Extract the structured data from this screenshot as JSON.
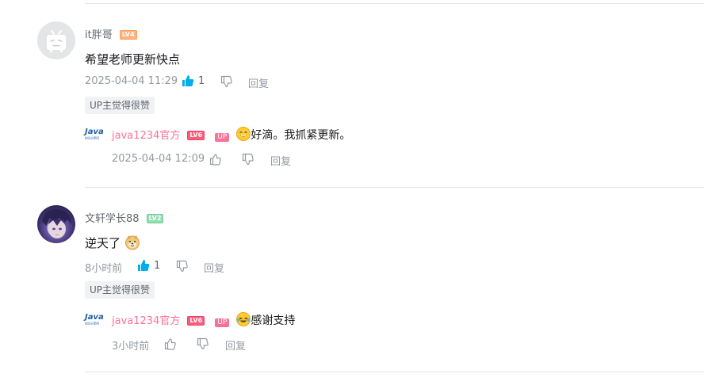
{
  "comments": [
    {
      "username": "it胖哥",
      "level": "LV4",
      "content": "希望老师更新快点",
      "time": "2025-04-04 11:29",
      "likes": "1",
      "reply_label": "回复",
      "tag": "UP主觉得很赞",
      "reply": {
        "username": "java1234官方",
        "level": "LV6",
        "up_badge": "UP",
        "text": "好滴。我抓紧更新。",
        "time": "2025-04-04 12:09",
        "reply_label": "回复"
      }
    },
    {
      "username": "文轩学长88",
      "level": "LV2",
      "content": "逆天了",
      "time": "8小时前",
      "likes": "1",
      "reply_label": "回复",
      "tag": "UP主觉得很赞",
      "reply": {
        "username": "java1234官方",
        "level": "LV6",
        "up_badge": "UP",
        "text": "感谢支持",
        "time": "3小时前",
        "reply_label": "回复"
      }
    }
  ],
  "java_logo": {
    "title": "Java",
    "subtitle": "知识分享网"
  },
  "colors": {
    "like_active": "#00aeec",
    "up_pink": "#fb7299",
    "meta_gray": "#9499a0"
  },
  "icons": {
    "avatar_1": "bilibili-tv-default-avatar",
    "avatar_2": "anime-character-avatar",
    "like": "thumbs-up-icon",
    "dislike": "thumbs-down-icon",
    "emoji_1": "smiling-face-emoji",
    "emoji_2": "doge-emoji",
    "emoji_3": "laughing-tears-emoji"
  }
}
